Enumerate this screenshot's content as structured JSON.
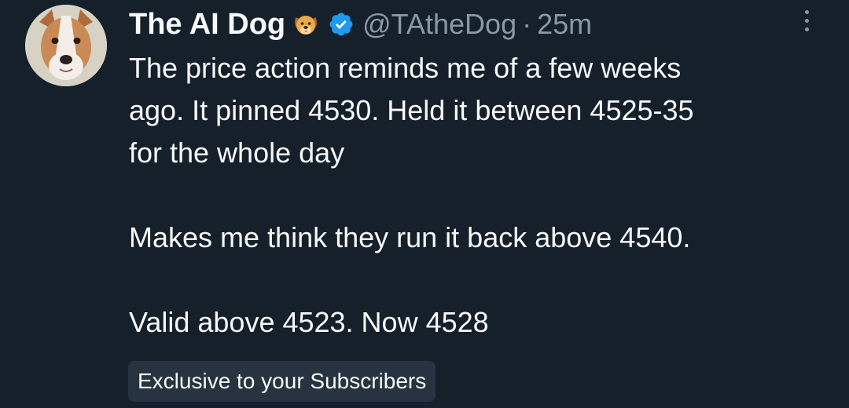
{
  "author": {
    "display_name": "The AI Dog",
    "name_emoji": "dog-face-icon",
    "verified_icon": "verified-badge-icon",
    "handle": "@TAtheDog",
    "separator": "·",
    "timestamp": "25m",
    "avatar": "avatar-dog-photo"
  },
  "tweet": {
    "lines": [
      "The price action reminds me of a few weeks",
      "ago. It pinned 4530. Held it between 4525-35",
      "for the whole day",
      "",
      "Makes me think they run it back above 4540.",
      "",
      "Valid above 4523. Now 4528"
    ]
  },
  "badge": {
    "label": "Exclusive to your Subscribers"
  },
  "more_menu": {
    "icon": "more-vertical-icon"
  },
  "colors": {
    "background": "#15202b",
    "primary_text": "#f7f9f9",
    "secondary_text": "#8b98a5",
    "verified_blue": "#1d9bf0",
    "badge_background": "#273340"
  }
}
